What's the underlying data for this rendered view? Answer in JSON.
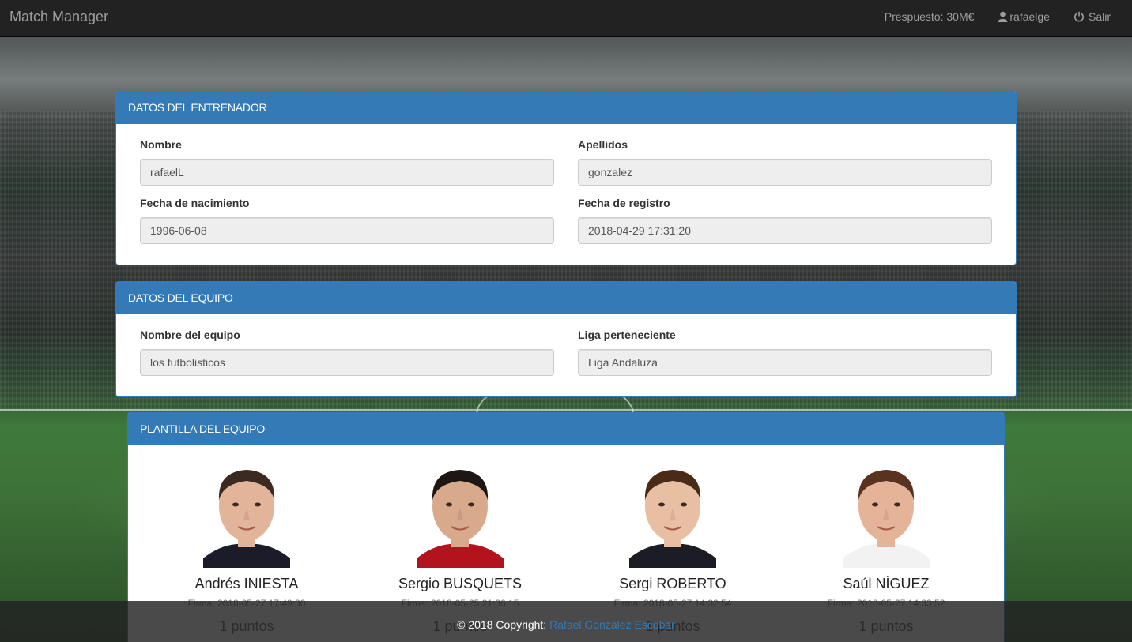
{
  "navbar": {
    "brand": "Match Manager",
    "budget": "Prespuesto: 30M€",
    "username": "rafaelge",
    "logout": "Salir"
  },
  "coach_panel": {
    "title": "DATOS DEL ENTRENADOR",
    "nombre_label": "Nombre",
    "nombre_value": "rafaelL",
    "apellidos_label": "Apellidos",
    "apellidos_value": "gonzalez",
    "nacimiento_label": "Fecha de nacimiento",
    "nacimiento_value": "1996-06-08",
    "registro_label": "Fecha de registro",
    "registro_value": "2018-04-29 17:31:20"
  },
  "team_panel": {
    "title": "DATOS DEL EQUIPO",
    "equipo_label": "Nombre del equipo",
    "equipo_value": "los futbolisticos",
    "liga_label": "Liga perteneciente",
    "liga_value": "Liga Andaluza"
  },
  "squad_panel": {
    "title": "PLANTILLA DEL EQUIPO",
    "players": [
      {
        "name": "Andrés INIESTA",
        "firma": "Firma: 2018-05-27 17:49:30",
        "points": "1 puntos",
        "skin": "#e2b49a",
        "hair": "#3a2a20",
        "shirt": "#1b1b2a"
      },
      {
        "name": "Sergio BUSQUETS",
        "firma": "Firma: 2018-05-25 21:36:15",
        "points": "1 puntos",
        "skin": "#d9a98c",
        "hair": "#1d1612",
        "shirt": "#b3131d"
      },
      {
        "name": "Sergi ROBERTO",
        "firma": "Firma: 2018-05-27 14:32:54",
        "points": "1 puntos",
        "skin": "#e8bfa3",
        "hair": "#4a2b18",
        "shirt": "#1c1c24"
      },
      {
        "name": "Saúl NÍGUEZ",
        "firma": "Firma: 2018-05-27 14:33:52",
        "points": "1 puntos",
        "skin": "#e4b398",
        "hair": "#5a3220",
        "shirt": "#f2f2f2"
      }
    ]
  },
  "footer": {
    "copyright": "© 2018 Copyright:",
    "author": "Rafael González Escobar"
  },
  "colors": {
    "primary": "#337ab7",
    "navbar": "#222222"
  }
}
